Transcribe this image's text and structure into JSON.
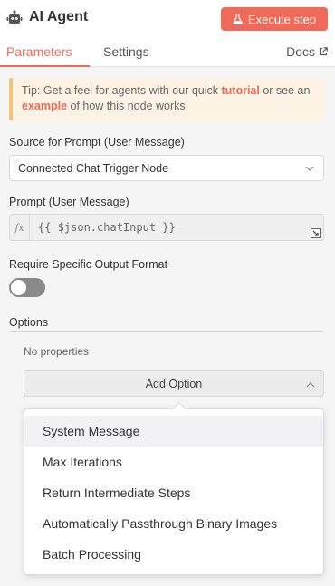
{
  "header": {
    "title": "AI Agent",
    "execute_label": "Execute step",
    "icon": "robot-icon",
    "accent_color": "#ef6a59"
  },
  "tabs": [
    {
      "label": "Parameters",
      "active": true
    },
    {
      "label": "Settings",
      "active": false
    }
  ],
  "docs_label": "Docs",
  "tip": {
    "prefix": "Tip: Get a feel for agents with our quick ",
    "link1": "tutorial",
    "middle": " or see an ",
    "link2": "example",
    "suffix": " of how this node works"
  },
  "source": {
    "label": "Source for Prompt (User Message)",
    "value": "Connected Chat Trigger Node"
  },
  "prompt": {
    "label": "Prompt (User Message)",
    "fx": "fx",
    "value": "{{ $json.chatInput }}"
  },
  "output_format": {
    "label": "Require Specific Output Format",
    "enabled": false
  },
  "options": {
    "label": "Options",
    "empty_text": "No properties",
    "add_label": "Add Option",
    "items": [
      "System Message",
      "Max Iterations",
      "Return Intermediate Steps",
      "Automatically Passthrough Binary Images",
      "Batch Processing"
    ],
    "highlighted_index": 0
  }
}
